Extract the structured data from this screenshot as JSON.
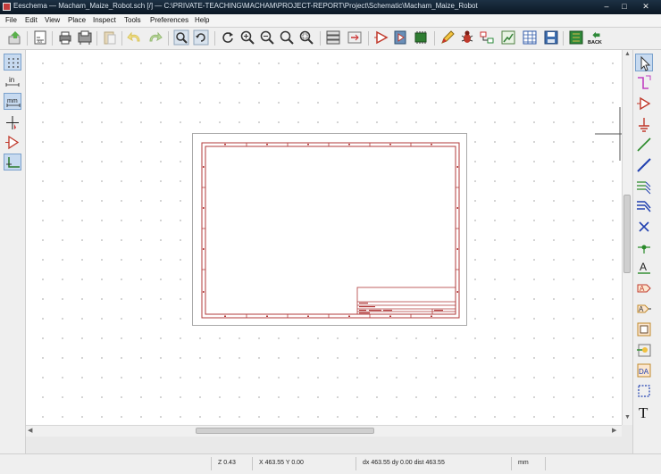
{
  "window": {
    "title": "Eeschema — Macham_Maize_Robot.sch [/] — C:\\PRIVATE-TEACHING\\MACHAM\\PROJECT-REPORT\\Project\\Schematic\\Macham_Maize_Robot"
  },
  "menu": [
    "File",
    "Edit",
    "View",
    "Place",
    "Inspect",
    "Tools",
    "Preferences",
    "Help"
  ],
  "toolbar": {
    "back_label": "BACK"
  },
  "left_tools": [
    "grid-icon",
    "units-inch-icon",
    "units-mm-icon",
    "cursor-shape-icon",
    "hidden-pins-icon",
    "wire-angle-icon"
  ],
  "right_tools": [
    "select-icon",
    "highlight-net-icon",
    "add-symbol-icon",
    "add-power-icon",
    "add-wire-icon",
    "add-bus-icon",
    "wire-to-bus-entry-icon",
    "bus-to-bus-entry-icon",
    "no-connect-icon",
    "junction-icon",
    "net-label-icon",
    "global-label-icon",
    "hierarchical-label-icon",
    "hierarchical-sheet-icon",
    "import-sheet-pin-icon",
    "add-sheet-pin-icon",
    "graphic-lines-icon",
    "add-text-icon"
  ],
  "status": {
    "zoom": "Z 0.43",
    "xy": "X 463.55  Y 0.00",
    "delta": "dx 463.55  dy 0.00  dist 463.55",
    "units": "mm"
  },
  "colors": {
    "sheet_border": "#b03a3a",
    "canvas": "#ffffff",
    "title_bar": "#0f2234",
    "selected_tool": "#c7daf0"
  }
}
